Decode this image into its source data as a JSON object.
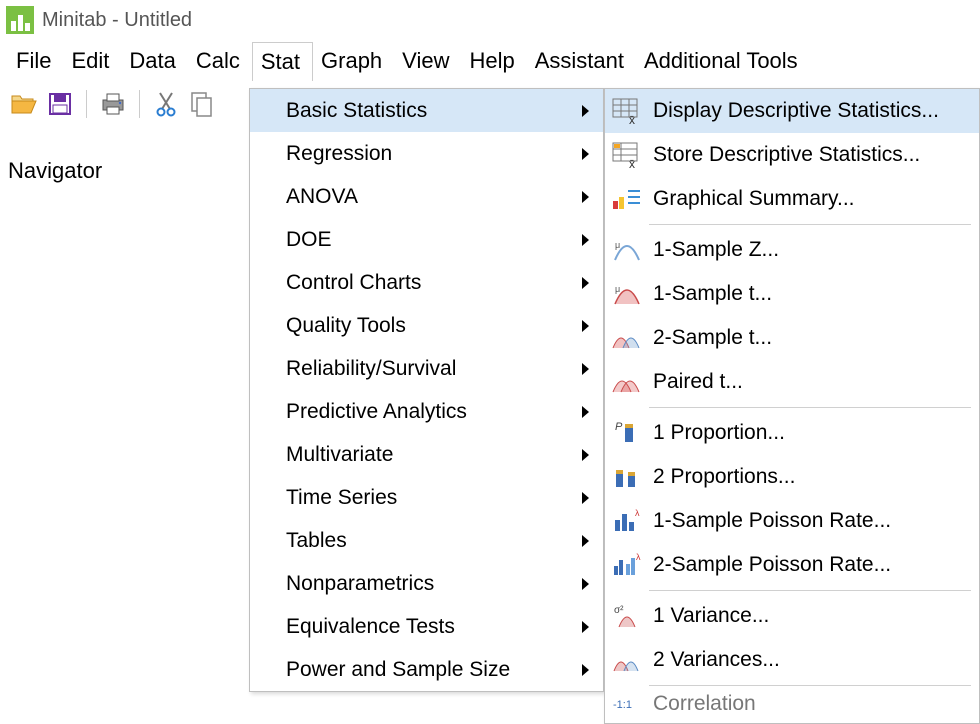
{
  "title": "Minitab - Untitled",
  "menubar": {
    "file": "File",
    "edit": "Edit",
    "data": "Data",
    "calc": "Calc",
    "stat": "Stat",
    "graph": "Graph",
    "view": "View",
    "help": "Help",
    "assistant": "Assistant",
    "additional": "Additional Tools"
  },
  "navigator": "Navigator",
  "stat_menu": {
    "basic": "Basic Statistics",
    "regression": "Regression",
    "anova": "ANOVA",
    "doe": "DOE",
    "control": "Control Charts",
    "quality": "Quality Tools",
    "reliability": "Reliability/Survival",
    "predictive": "Predictive Analytics",
    "multivariate": "Multivariate",
    "timeseries": "Time Series",
    "tables": "Tables",
    "nonparam": "Nonparametrics",
    "equiv": "Equivalence Tests",
    "power": "Power and Sample Size"
  },
  "basic_submenu": {
    "display_desc": "Display Descriptive Statistics...",
    "store_desc": "Store Descriptive Statistics...",
    "graphical": "Graphical Summary...",
    "onez": "1-Sample Z...",
    "onet": "1-Sample t...",
    "twot": "2-Sample t...",
    "paired": "Paired t...",
    "onep": "1 Proportion...",
    "twop": "2 Proportions...",
    "onepoisson": "1-Sample Poisson Rate...",
    "twopoisson": "2-Sample Poisson Rate...",
    "onevar": "1 Variance...",
    "twovar": "2 Variances...",
    "correl": "Correlation"
  }
}
